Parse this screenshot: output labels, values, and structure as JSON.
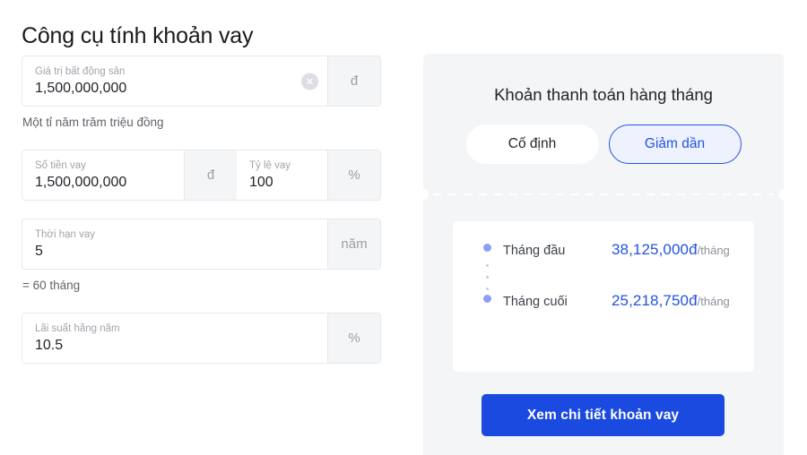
{
  "page": {
    "title": "Công cụ tính khoản vay"
  },
  "form": {
    "property_value": {
      "label": "Giá trị bất động sản",
      "value": "1,500,000,000",
      "suffix": "đ",
      "clear_icon": "clear-circle-icon",
      "helper": "Một tỉ năm trăm triệu đồng"
    },
    "loan_amount": {
      "label": "Số tiền vay",
      "value": "1,500,000,000",
      "suffix": "đ"
    },
    "loan_ratio": {
      "label": "Tỷ lệ vay",
      "value": "100",
      "suffix": "%"
    },
    "loan_term": {
      "label": "Thời hạn vay",
      "value": "5",
      "suffix": "năm",
      "helper": "= 60 tháng"
    },
    "interest_rate": {
      "label": "Lãi suất hằng năm",
      "value": "10.5",
      "suffix": "%"
    }
  },
  "result_panel": {
    "heading": "Khoản thanh toán hàng tháng",
    "toggles": [
      {
        "label": "Cố định",
        "active": false
      },
      {
        "label": "Giảm dần",
        "active": true
      }
    ],
    "rows": [
      {
        "label": "Tháng đầu",
        "amount": "38,125,000đ",
        "unit": "/tháng"
      },
      {
        "label": "Tháng cuối",
        "amount": "25,218,750đ",
        "unit": "/tháng"
      }
    ],
    "cta_label": "Xem chi tiết khoản vay"
  },
  "colors": {
    "accent_blue": "#2453e0",
    "cta_blue": "#1b4ae0",
    "panel_bg": "#f4f5f7",
    "bullet": "#8e9ef0",
    "text_primary": "#22252a",
    "text_muted": "#a0a4ab"
  }
}
